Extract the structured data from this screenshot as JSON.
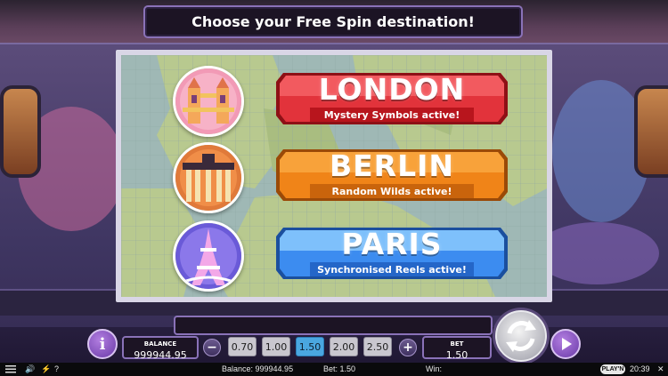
{
  "title": "Choose your Free Spin destination!",
  "destinations": [
    {
      "name": "LONDON",
      "subtitle": "Mystery Symbols active!",
      "color": "#d8262f",
      "icon": "tower-bridge-icon"
    },
    {
      "name": "BERLIN",
      "subtitle": "Random Wilds active!",
      "color": "#f07d12",
      "icon": "brandenburg-gate-icon"
    },
    {
      "name": "PARIS",
      "subtitle": "Synchronised Reels active!",
      "color": "#2f7fe0",
      "icon": "eiffel-tower-icon"
    }
  ],
  "hud": {
    "info_label": "i",
    "balance_label": "BALANCE",
    "balance_value": "999944.95",
    "minus_label": "−",
    "plus_label": "+",
    "bet_options": [
      "0.70",
      "1.00",
      "1.50",
      "2.00",
      "2.50"
    ],
    "selected_bet": "1.50",
    "bet_label": "BET",
    "bet_value": "1.50"
  },
  "status_bar": {
    "balance_text": "Balance: 999944.95",
    "bet_text": "Bet: 1.50",
    "win_text": "Win:",
    "brand": "PLAY'N GO",
    "time": "20:39"
  }
}
